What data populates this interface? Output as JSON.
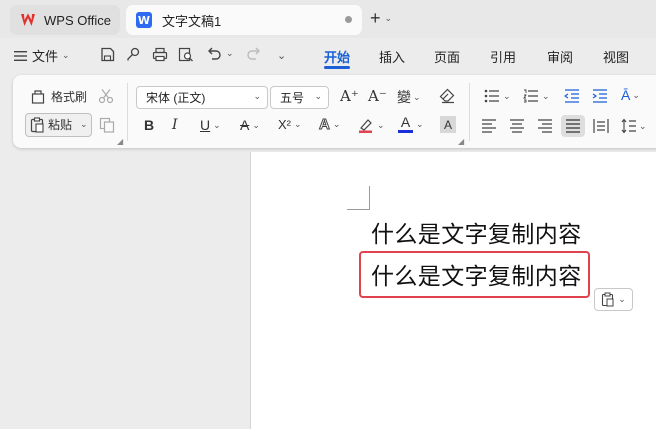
{
  "tabs": {
    "app_label": "WPS Office",
    "doc_label": "文字文稿1"
  },
  "menu": {
    "file_label": "文件",
    "ribbon_tabs": [
      "开始",
      "插入",
      "页面",
      "引用",
      "审阅",
      "视图"
    ],
    "active_tab": "开始"
  },
  "ribbon": {
    "format_painter_label": "格式刷",
    "paste_label": "粘贴",
    "font_name": "宋体 (正文)",
    "font_size": "五号",
    "bold_glyph": "B",
    "italic_glyph": "I",
    "underline_glyph": "U",
    "strike_glyph": "A",
    "superscript_glyph": "X²",
    "text_effect_glyph": "A",
    "font_color_glyph": "A",
    "char_shade_glyph": "A",
    "grow_glyph": "A⁺",
    "shrink_glyph": "A⁻",
    "font_color": "#1a2fd8",
    "highlight_color": "#e0424e"
  },
  "document": {
    "line1": "什么是文字复制内容",
    "line2": "什么是文字复制内容"
  },
  "colors": {
    "accent": "#1a5fd8",
    "selection_border": "#e0424e"
  }
}
